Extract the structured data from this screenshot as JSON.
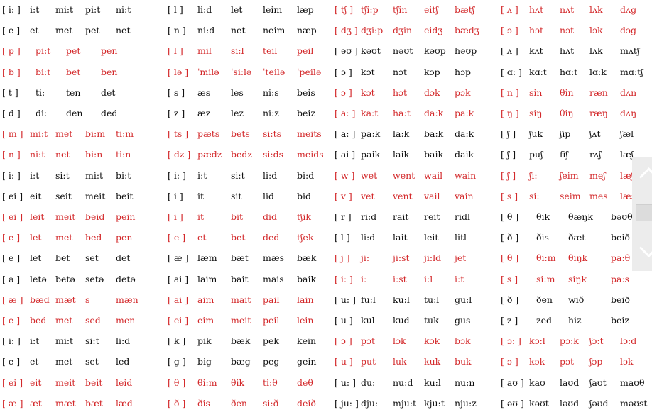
{
  "colors": {
    "text": "#111111",
    "highlight": "#d3292b"
  },
  "columns": [
    [
      {
        "ipa": "i:",
        "red": false,
        "words": [
          "i:t",
          "mi:t",
          "pi:t",
          "ni:t"
        ]
      },
      {
        "ipa": "e",
        "red": false,
        "words": [
          "et",
          "met",
          "pet",
          "net"
        ]
      },
      {
        "ipa": "p",
        "red": true,
        "words": [
          "pi:t",
          "pet",
          "pen"
        ]
      },
      {
        "ipa": "b",
        "red": true,
        "words": [
          "bi:t",
          "bet",
          "ben"
        ]
      },
      {
        "ipa": "t",
        "red": false,
        "words": [
          "ti:",
          "ten",
          "det"
        ]
      },
      {
        "ipa": "d",
        "red": false,
        "words": [
          "di:",
          "den",
          "ded"
        ]
      },
      {
        "ipa": "m",
        "red": true,
        "words": [
          "mi:t",
          "met",
          "bi:m",
          "ti:m"
        ]
      },
      {
        "ipa": "n",
        "red": true,
        "words": [
          "ni:t",
          "net",
          "bi:n",
          "ti:n"
        ]
      },
      {
        "ipa": "i:",
        "red": false,
        "words": [
          "i:t",
          "si:t",
          "mi:t",
          "bi:t"
        ]
      },
      {
        "ipa": "ei",
        "red": false,
        "words": [
          "eit",
          "seit",
          "meit",
          "beit"
        ]
      },
      {
        "ipa": "ei",
        "red": true,
        "words": [
          "leit",
          "meit",
          "beid",
          "pein"
        ]
      },
      {
        "ipa": "e",
        "red": true,
        "words": [
          "let",
          "met",
          "bed",
          "pen"
        ]
      },
      {
        "ipa": "e",
        "red": false,
        "words": [
          "let",
          "bet",
          "set",
          "det"
        ]
      },
      {
        "ipa": "ə",
        "red": false,
        "words": [
          "letə",
          "betə",
          "setə",
          "detə"
        ]
      },
      {
        "ipa": "æ",
        "red": true,
        "words": [
          "bæd",
          "mæt",
          "s",
          "mæn"
        ]
      },
      {
        "ipa": "e",
        "red": true,
        "words": [
          "bed",
          "met",
          "sed",
          "men"
        ]
      },
      {
        "ipa": "i:",
        "red": false,
        "words": [
          "i:t",
          "mi:t",
          "si:t",
          "li:d"
        ]
      },
      {
        "ipa": "e",
        "red": false,
        "words": [
          "et",
          "met",
          "set",
          "led"
        ]
      },
      {
        "ipa": "ei",
        "red": true,
        "words": [
          "eit",
          "meit",
          "beit",
          "leid"
        ]
      },
      {
        "ipa": "æ",
        "red": true,
        "words": [
          "æt",
          "mæt",
          "bæt",
          "læd"
        ]
      }
    ],
    [
      {
        "ipa": "l",
        "red": false,
        "words": [
          "li:d",
          "let",
          "leim",
          "læp"
        ]
      },
      {
        "ipa": "n",
        "red": false,
        "words": [
          "ni:d",
          "net",
          "neim",
          "næp"
        ]
      },
      {
        "ipa": "l",
        "red": true,
        "words": [
          "mil",
          "si:l",
          "teil",
          "peil"
        ]
      },
      {
        "ipa": "lə",
        "red": true,
        "words": [
          "ˈmilə",
          "ˈsi:lə",
          "ˈteilə",
          "ˈpeilə"
        ]
      },
      {
        "ipa": "s",
        "red": false,
        "words": [
          "æs",
          "les",
          "ni:s",
          "beis"
        ]
      },
      {
        "ipa": "z",
        "red": false,
        "words": [
          "æz",
          "lez",
          "ni:z",
          "beiz"
        ]
      },
      {
        "ipa": "ts",
        "red": true,
        "words": [
          "pæts",
          "bets",
          "si:ts",
          "meits"
        ]
      },
      {
        "ipa": "dz",
        "red": true,
        "words": [
          "pædz",
          "bedz",
          "si:ds",
          "meids"
        ]
      },
      {
        "ipa": "i:",
        "red": false,
        "words": [
          "i:t",
          "si:t",
          "li:d",
          "bi:d"
        ]
      },
      {
        "ipa": "i",
        "red": false,
        "words": [
          "it",
          "sit",
          "lid",
          "bid"
        ]
      },
      {
        "ipa": "i",
        "red": true,
        "words": [
          "it",
          "bit",
          "did",
          "tʃik"
        ]
      },
      {
        "ipa": "e",
        "red": true,
        "words": [
          "et",
          "bet",
          "ded",
          "tʃek"
        ]
      },
      {
        "ipa": "æ",
        "red": false,
        "words": [
          "læm",
          "bæt",
          "mæs",
          "bæk"
        ]
      },
      {
        "ipa": "ai",
        "red": false,
        "words": [
          "laim",
          "bait",
          "mais",
          "baik"
        ]
      },
      {
        "ipa": "ai",
        "red": true,
        "words": [
          "aim",
          "mait",
          "pail",
          "lain"
        ]
      },
      {
        "ipa": "ei",
        "red": true,
        "words": [
          "eim",
          "meit",
          "peil",
          "lein"
        ]
      },
      {
        "ipa": "k",
        "red": false,
        "words": [
          "pik",
          "bæk",
          "pek",
          "kein"
        ]
      },
      {
        "ipa": "g",
        "red": false,
        "words": [
          "big",
          "bæg",
          "peg",
          "gein"
        ]
      },
      {
        "ipa": "θ",
        "red": true,
        "words": [
          "θi:m",
          "θik",
          "ti:θ",
          "deθ"
        ]
      },
      {
        "ipa": "ð",
        "red": true,
        "words": [
          "ðis",
          "ðen",
          "si:ð",
          "deið"
        ]
      }
    ],
    [
      {
        "ipa": "tʃ",
        "red": true,
        "words": [
          "tʃi:p",
          "tʃin",
          "eitʃ",
          "bætʃ"
        ]
      },
      {
        "ipa": "dʒ",
        "red": true,
        "words": [
          "dʒi:p",
          "dʒin",
          "eidʒ",
          "bædʒ"
        ]
      },
      {
        "ipa": "əʊ",
        "red": false,
        "words": [
          "kəʊt",
          "nəʊt",
          "kəʊp",
          "həʊp"
        ]
      },
      {
        "ipa": "ɔ",
        "red": false,
        "words": [
          "kɔt",
          "nɔt",
          "kɔp",
          "hɔp"
        ]
      },
      {
        "ipa": "ɔ",
        "red": true,
        "words": [
          "kɔt",
          "hɔt",
          "dɔk",
          "pɔk"
        ]
      },
      {
        "ipa": "a:",
        "red": true,
        "words": [
          "ka:t",
          "ha:t",
          "da:k",
          "pa:k"
        ]
      },
      {
        "ipa": "a:",
        "red": false,
        "words": [
          "pa:k",
          "la:k",
          "ba:k",
          "da:k"
        ]
      },
      {
        "ipa": "ai",
        "red": false,
        "words": [
          "paik",
          "laik",
          "baik",
          "daik"
        ]
      },
      {
        "ipa": "w",
        "red": true,
        "words": [
          "wet",
          "went",
          "wail",
          "wain"
        ]
      },
      {
        "ipa": "v",
        "red": true,
        "words": [
          "vet",
          "vent",
          "vail",
          "vain"
        ]
      },
      {
        "ipa": "r",
        "red": false,
        "words": [
          "ri:d",
          "rait",
          "reit",
          "ridl"
        ]
      },
      {
        "ipa": "l",
        "red": false,
        "words": [
          "li:d",
          "lait",
          "leit",
          "litl"
        ]
      },
      {
        "ipa": "j",
        "red": true,
        "words": [
          "ji:",
          "ji:st",
          "ji:ld",
          "jet"
        ]
      },
      {
        "ipa": "i:",
        "red": true,
        "words": [
          "i:",
          "i:st",
          "i:l",
          "i:t"
        ]
      },
      {
        "ipa": "u:",
        "red": false,
        "words": [
          "fu:l",
          "ku:l",
          "tu:l",
          "gu:l"
        ]
      },
      {
        "ipa": "u",
        "red": false,
        "words": [
          "kul",
          "kud",
          "tuk",
          "gus"
        ]
      },
      {
        "ipa": "ɔ",
        "red": true,
        "words": [
          "pɔt",
          "lɔk",
          "kɔk",
          "bɔk"
        ]
      },
      {
        "ipa": "u",
        "red": true,
        "words": [
          "put",
          "luk",
          "kuk",
          "buk"
        ]
      },
      {
        "ipa": "u:",
        "red": false,
        "words": [
          "du:",
          "nu:d",
          "ku:l",
          "nu:n"
        ]
      },
      {
        "ipa": "ju:",
        "red": false,
        "words": [
          "dju:",
          "mju:t",
          "kju:t",
          "nju:z"
        ]
      }
    ],
    [
      {
        "ipa": "ʌ",
        "red": true,
        "words": [
          "hʌt",
          "nʌt",
          "lʌk",
          "dʌg"
        ]
      },
      {
        "ipa": "ɔ",
        "red": true,
        "words": [
          "hɔt",
          "nɔt",
          "lɔk",
          "dɔg"
        ]
      },
      {
        "ipa": "ʌ",
        "red": false,
        "words": [
          "kʌt",
          "hʌt",
          "lʌk",
          "mʌtʃ"
        ]
      },
      {
        "ipa": "ɑ:",
        "red": false,
        "words": [
          "kɑ:t",
          "hɑ:t",
          "lɑ:k",
          "mɑ:tʃ"
        ]
      },
      {
        "ipa": "n",
        "red": true,
        "words": [
          "sin",
          "θin",
          "ræn",
          "dʌn"
        ]
      },
      {
        "ipa": "ŋ",
        "red": true,
        "words": [
          "siŋ",
          "θiŋ",
          "ræŋ",
          "dʌŋ"
        ]
      },
      {
        "ipa": "ʃ",
        "red": false,
        "words": [
          "ʃuk",
          "ʃip",
          "ʃʌt",
          "ʃæl"
        ]
      },
      {
        "ipa": "ʃ",
        "red": false,
        "words": [
          "puʃ",
          "fiʃ",
          "rʌʃ",
          "læʃ"
        ]
      },
      {
        "ipa": "ʃ",
        "red": true,
        "words": [
          "ʃi:",
          "ʃeim",
          "meʃ",
          "læʃ"
        ]
      },
      {
        "ipa": "s",
        "red": true,
        "words": [
          "si:",
          "seim",
          "mes",
          "læs"
        ]
      },
      {
        "ipa": "θ",
        "red": false,
        "words": [
          "θik",
          "θæŋk",
          "bəʊθ"
        ]
      },
      {
        "ipa": "ð",
        "red": false,
        "words": [
          "ðis",
          "ðæt",
          "beið"
        ]
      },
      {
        "ipa": "θ",
        "red": true,
        "words": [
          "θi:m",
          "θiŋk",
          "pa:θ"
        ]
      },
      {
        "ipa": "s",
        "red": true,
        "words": [
          "si:m",
          "siŋk",
          "pa:s"
        ]
      },
      {
        "ipa": "ð",
        "red": false,
        "words": [
          "ðen",
          "wið",
          "beið"
        ]
      },
      {
        "ipa": "z",
        "red": false,
        "words": [
          "zed",
          "hiz",
          "beiz"
        ]
      },
      {
        "ipa": "ɔ:",
        "red": true,
        "words": [
          "kɔ:l",
          "pɔ:k",
          "ʃɔ:t",
          "lɔ:d"
        ]
      },
      {
        "ipa": "ɔ",
        "red": true,
        "words": [
          "kɔk",
          "pɔt",
          "ʃɔp",
          "lɔk"
        ]
      },
      {
        "ipa": "aʊ",
        "red": false,
        "words": [
          "kaʊ",
          "laʊd",
          "ʃaʊt",
          "maʊθ"
        ]
      },
      {
        "ipa": "əʊ",
        "red": false,
        "words": [
          "kəʊt",
          "ləʊd",
          "ʃəʊd",
          "məʊst"
        ]
      }
    ]
  ],
  "scroll_widget": {
    "icons": [
      "chevron-up-icon",
      "chevron-down-icon"
    ]
  }
}
